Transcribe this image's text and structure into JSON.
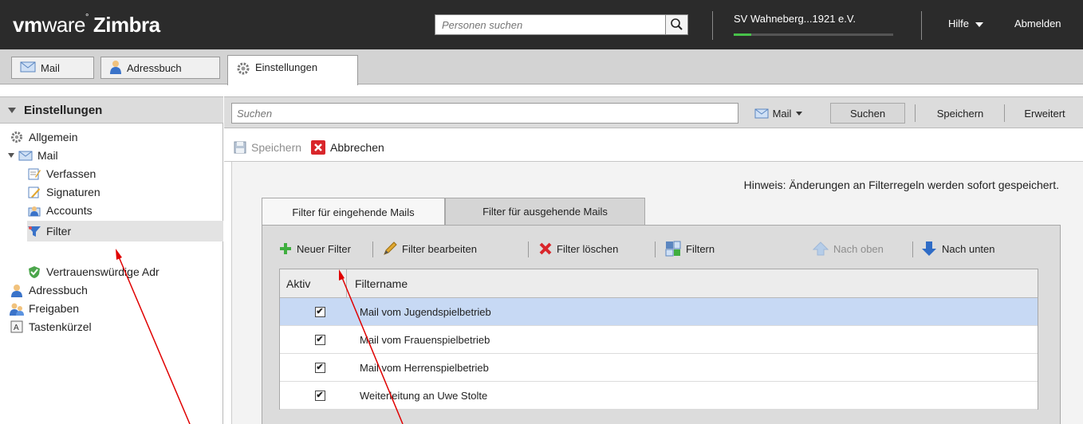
{
  "header": {
    "logo": {
      "vm": "vm",
      "ware": "ware",
      "zimbra": "Zimbra"
    },
    "people_search": {
      "placeholder": "Personen suchen"
    },
    "account": {
      "name": "SV Wahneberg...1921 e.V.",
      "quota_fraction": 0.11
    },
    "help_label": "Hilfe",
    "logout_label": "Abmelden"
  },
  "app_tabs": [
    {
      "label": "Mail",
      "icon": "mail-icon"
    },
    {
      "label": "Adressbuch",
      "icon": "contacts-icon"
    },
    {
      "label": "Einstellungen",
      "icon": "gear-icon",
      "active": true
    }
  ],
  "sidebar": {
    "title": "Einstellungen",
    "items": [
      {
        "label": "Allgemein",
        "icon": "gear-icon"
      },
      {
        "label": "Mail",
        "icon": "mail-icon"
      },
      {
        "label": "Verfassen",
        "icon": "compose-icon"
      },
      {
        "label": "Signaturen",
        "icon": "signature-icon"
      },
      {
        "label": "Accounts",
        "icon": "accounts-icon"
      },
      {
        "label": "Filter",
        "icon": "filter-icon"
      },
      {
        "label": "Vertrauenswürdige Adr",
        "icon": "shield-icon"
      },
      {
        "label": "Adressbuch",
        "icon": "person-icon"
      },
      {
        "label": "Freigaben",
        "icon": "shared-people-icon"
      },
      {
        "label": "Tastenkürzel",
        "icon": "keyboard-icon"
      }
    ]
  },
  "searchbar": {
    "placeholder": "Suchen",
    "type_label": "Mail",
    "search_label": "Suchen",
    "save_label": "Speichern",
    "advanced_label": "Erweitert"
  },
  "toolbar": {
    "save_label": "Speichern",
    "cancel_label": "Abbrechen"
  },
  "hint": "Hinweis: Änderungen an Filterregeln werden sofort gespeichert.",
  "filter_tabs": [
    {
      "label": "Filter für eingehende Mails",
      "active": true
    },
    {
      "label": "Filter für ausgehende Mails",
      "active": false
    }
  ],
  "filter_toolbar": {
    "new_label": "Neuer Filter",
    "edit_label": "Filter bearbeiten",
    "delete_label": "Filter löschen",
    "run_label": "Filtern",
    "up_label": "Nach oben",
    "down_label": "Nach unten"
  },
  "filter_table": {
    "col_active": "Aktiv",
    "col_name": "Filtername",
    "rows": [
      {
        "name": "Mail vom Jugendspielbetrieb",
        "active": true,
        "selected": true
      },
      {
        "name": "Mail vom Frauenspielbetrieb",
        "active": true
      },
      {
        "name": "Mail vom Herrenspielbetrieb",
        "active": true
      },
      {
        "name": "Weiterleitung an Uwe Stolte",
        "active": true
      }
    ]
  },
  "colors": {
    "header_bg": "#2b2b2b",
    "selection": "#c7d9f4",
    "annotation_arrow": "#e00000"
  }
}
